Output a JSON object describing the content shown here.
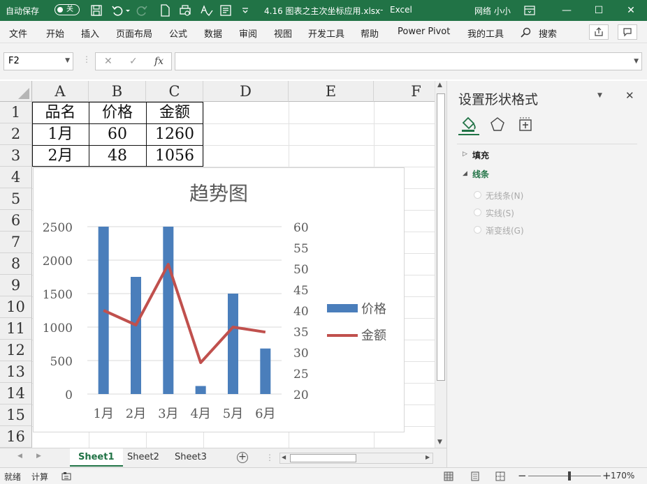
{
  "titlebar": {
    "autosave_label": "自动保存",
    "autosave_state": "关",
    "filename": "4.16 图表之主次坐标应用.xlsx",
    "separator": "-",
    "app": "Excel",
    "user": "网络 小小",
    "minimize": "—",
    "maximize": "☐",
    "close": "✕"
  },
  "menu": {
    "items": [
      "文件",
      "开始",
      "插入",
      "页面布局",
      "公式",
      "数据",
      "审阅",
      "视图",
      "开发工具",
      "帮助",
      "Power Pivot",
      "我的工具"
    ],
    "search": "搜索"
  },
  "formula": {
    "namebox": "F2",
    "cancel": "✕",
    "confirm": "✓",
    "fx": "fx",
    "value": ""
  },
  "sheet": {
    "columns": [
      "A",
      "B",
      "C",
      "D",
      "E",
      "F"
    ],
    "rows": [
      "1",
      "2",
      "3",
      "4",
      "5",
      "6",
      "7",
      "8",
      "9",
      "10",
      "11",
      "12",
      "13",
      "14",
      "15",
      "16"
    ],
    "table": [
      [
        "品名",
        "价格",
        "金额"
      ],
      [
        "1月",
        "60",
        "1260"
      ],
      [
        "2月",
        "48",
        "1056"
      ]
    ]
  },
  "chart_data": {
    "type": "bar",
    "title": "趋势图",
    "categories": [
      "1月",
      "2月",
      "3月",
      "4月",
      "5月",
      "6月"
    ],
    "series": [
      {
        "name": "价格",
        "kind": "bar",
        "axis": "primary",
        "color": "#4a7ebb",
        "values": [
          2500,
          1750,
          2500,
          120,
          1500,
          680
        ]
      },
      {
        "name": "金额",
        "kind": "line",
        "axis": "secondary",
        "color": "#c0504d",
        "values": [
          40,
          36.5,
          51,
          27.5,
          36,
          34.8
        ]
      }
    ],
    "primary_axis": {
      "min": 0,
      "max": 2500,
      "ticks": [
        "0",
        "500",
        "1000",
        "1500",
        "2000",
        "2500"
      ]
    },
    "secondary_axis": {
      "min": 20,
      "max": 60,
      "ticks": [
        "20",
        "25",
        "30",
        "35",
        "40",
        "45",
        "50",
        "55",
        "60"
      ]
    },
    "legend": "right",
    "grid": true
  },
  "tabs": [
    "Sheet1",
    "Sheet2",
    "Sheet3"
  ],
  "add_sheet": "+",
  "status": {
    "ready": "就绪",
    "calc": "计算",
    "zoom_minus": "−",
    "zoom_plus": "+",
    "zoom": "170%",
    "zoom_fraction": 0.57
  },
  "pane": {
    "title": "设置形状格式",
    "fill": "填充",
    "line": "线条",
    "options": [
      "无线条(N)",
      "实线(S)",
      "渐变线(G)"
    ],
    "collapse": "▼",
    "close": "✕"
  },
  "colors": {
    "excel_green": "#217346",
    "bar": "#4a7ebb",
    "line": "#c0504d"
  }
}
